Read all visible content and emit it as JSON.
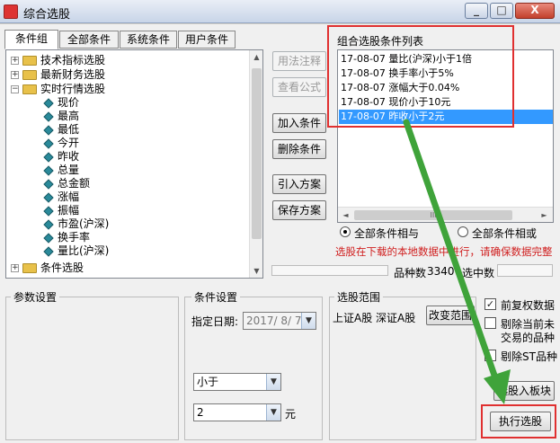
{
  "window": {
    "title": "综合选股",
    "minimize": "_",
    "maximize": "□",
    "close": "X"
  },
  "tabs": [
    "条件组",
    "全部条件",
    "系统条件",
    "用户条件"
  ],
  "tree": {
    "categories_top": [
      {
        "label": "技术指标选股",
        "expander": "+"
      },
      {
        "label": "最新财务选股",
        "expander": "+"
      },
      {
        "label": "实时行情选股",
        "expander": "−"
      }
    ],
    "realtime_items": [
      "现价",
      "最高",
      "最低",
      "今开",
      "昨收",
      "总量",
      "总金额",
      "涨幅",
      "振幅",
      "市盈(沪深)",
      "换手率",
      "量比(沪深)"
    ],
    "categories_bottom": [
      {
        "label": "条件选股",
        "expander": "+"
      }
    ]
  },
  "buttons": {
    "usage_note": "用法注释",
    "view_formula": "查看公式",
    "add_condition": "加入条件",
    "delete_condition": "删除条件",
    "import_plan": "引入方案",
    "save_plan": "保存方案",
    "change_range": "改变范围",
    "add_to_block": "选股入板块",
    "execute": "执行选股"
  },
  "condition_list": {
    "title": "组合选股条件列表",
    "items": [
      "17-08-07 量比(沪深)小于1倍",
      "17-08-07 换手率小于5%",
      "17-08-07 涨幅大于0.04%",
      "17-08-07 现价小于10元",
      "17-08-07 昨收小于2元"
    ],
    "selected_index": 4,
    "scroll_glyph": "III"
  },
  "logic": {
    "and_label": "全部条件相与",
    "or_label": "全部条件相或",
    "selected": "and"
  },
  "warning": "选股在下载的本地数据中进行，请确保数据完整",
  "stats": {
    "stock_count_label": "品种数",
    "stock_count": "3340",
    "selected_count_label": "选中数",
    "selected_count": ""
  },
  "params": {
    "title": "参数设置"
  },
  "condition_settings": {
    "title": "条件设置",
    "date_label": "指定日期:",
    "date_value": "2017/ 8/ 7",
    "operator_value": "小于",
    "value": "2",
    "unit": "元"
  },
  "range": {
    "title": "选股范围",
    "markets": "上证A股  深证A股"
  },
  "options": {
    "forward_adjust": {
      "label": "前复权数据",
      "checked": true
    },
    "exclude_untradable_line1": "剔除当前未",
    "exclude_untradable_line2": "交易的品种",
    "exclude_untradable_checked": false,
    "exclude_st": {
      "label": "剔除ST品种",
      "checked": false
    }
  }
}
